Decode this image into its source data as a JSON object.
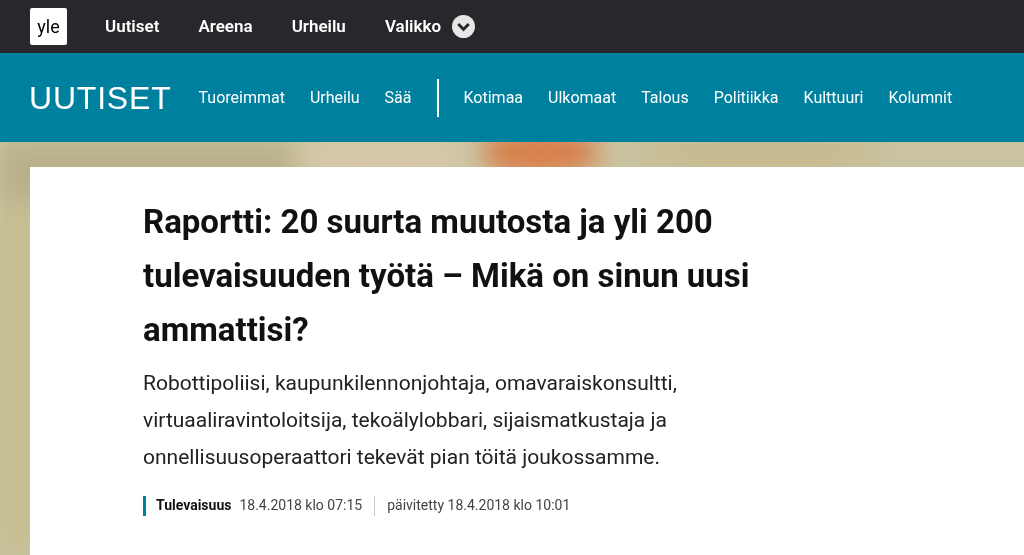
{
  "top_nav": {
    "logo": "yle",
    "items": [
      "Uutiset",
      "Areena",
      "Urheilu",
      "Valikko"
    ]
  },
  "section_nav": {
    "title": "UUTISET",
    "primary": [
      "Tuoreimmat",
      "Urheilu",
      "Sää"
    ],
    "secondary": [
      "Kotimaa",
      "Ulkomaat",
      "Talous",
      "Politiikka",
      "Kulttuuri",
      "Kolumnit"
    ]
  },
  "article": {
    "headline": "Raportti: 20 suurta muutosta ja yli 200 tulevaisuuden työtä – Mikä on sinun uusi ammattisi?",
    "lead": "Robottipoliisi, kaupunkilennonjohtaja, omavaraiskonsultti, virtuaaliravintoloitsija, tekoälylobbari, sijaismatkustaja ja onnellisuusoperaattori tekevät pian töitä joukossamme.",
    "category": "Tulevaisuus",
    "published": "18.4.2018 klo 07:15",
    "updated": "päivitetty 18.4.2018 klo 10:01"
  }
}
